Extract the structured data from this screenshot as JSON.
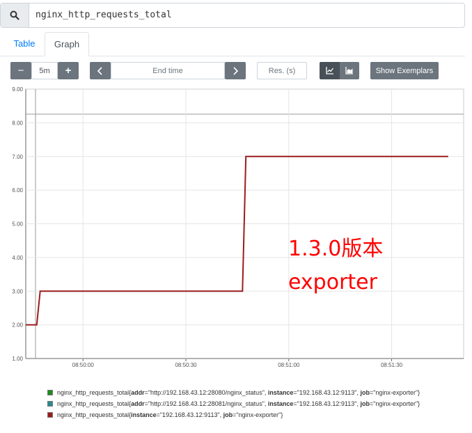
{
  "search": {
    "expression": "nginx_http_requests_total",
    "icon": "search-icon"
  },
  "tabs": [
    {
      "label": "Table"
    },
    {
      "label": "Graph"
    }
  ],
  "controls": {
    "range_minus": "−",
    "range_value": "5m",
    "range_plus": "+",
    "prev_icon": "chevron-left-icon",
    "end_time_placeholder": "End time",
    "next_icon": "chevron-right-icon",
    "resolution_placeholder": "Res. (s)",
    "chart_type_line_icon": "line-chart-icon",
    "chart_type_stacked_icon": "stacked-chart-icon",
    "show_exemplars": "Show Exemplars"
  },
  "chart_data": {
    "type": "line",
    "y_ticks": [
      "1.00",
      "2.00",
      "3.00",
      "4.00",
      "5.00",
      "6.00",
      "7.00",
      "8.00",
      "9.00"
    ],
    "ylim": [
      1,
      9
    ],
    "x_ticks": [
      "08:50:00",
      "08:50:30",
      "08:51:00",
      "08:51:30"
    ],
    "x_tick_seconds": [
      0,
      30,
      60,
      90
    ],
    "xlim_seconds": [
      -16.7,
      111
    ],
    "series": [
      {
        "color": "#9b1c1c",
        "points": [
          [
            -16.7,
            2
          ],
          [
            -13.5,
            2
          ],
          [
            -12.5,
            3
          ],
          [
            46.5,
            3
          ],
          [
            47.5,
            7
          ],
          [
            106.5,
            7
          ]
        ]
      }
    ]
  },
  "legend": [
    {
      "color": "#1e8a1e",
      "prefix": "nginx_http_requests_total{",
      "parts": [
        {
          "k": "addr",
          "v": "=\"http://192.168.43.12:28080/nginx_status\", "
        },
        {
          "k": "instance",
          "v": "=\"192.168.43.12:9113\", "
        },
        {
          "k": "job",
          "v": "=\"nginx-exporter\"}"
        }
      ]
    },
    {
      "color": "#2a8a8a",
      "prefix": "nginx_http_requests_total{",
      "parts": [
        {
          "k": "addr",
          "v": "=\"http://192.168.43.12:28081/nginx_status\", "
        },
        {
          "k": "instance",
          "v": "=\"192.168.43.12:9113\", "
        },
        {
          "k": "job",
          "v": "=\"nginx-exporter\"}"
        }
      ]
    },
    {
      "color": "#9b1c1c",
      "prefix": "nginx_http_requests_total{",
      "parts": [
        {
          "k": "instance",
          "v": "=\"192.168.43.12:9113\", "
        },
        {
          "k": "job",
          "v": "=\"nginx-exporter\"}"
        }
      ]
    }
  ],
  "annotation": {
    "line1": "1.3.0版本",
    "line2": "exporter",
    "color": "#ff0000"
  }
}
